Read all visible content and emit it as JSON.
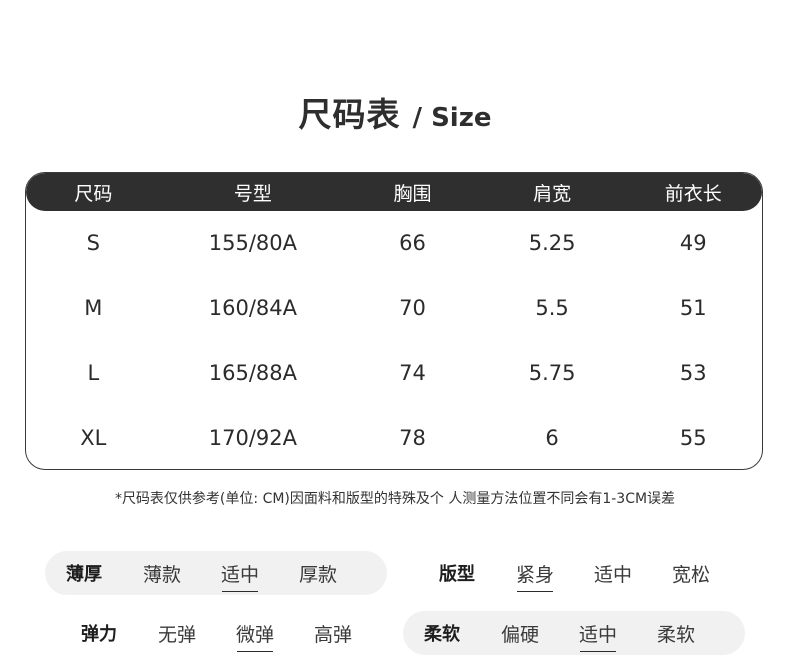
{
  "title": {
    "cn": "尺码表",
    "en": "/ Size"
  },
  "table": {
    "headers": [
      "尺码",
      "号型",
      "胸围",
      "肩宽",
      "前衣长"
    ],
    "rows": [
      [
        "S",
        "155/80A",
        "66",
        "5.25",
        "49"
      ],
      [
        "M",
        "160/84A",
        "70",
        "5.5",
        "51"
      ],
      [
        "L",
        "165/88A",
        "74",
        "5.75",
        "53"
      ],
      [
        "XL",
        "170/92A",
        "78",
        "6",
        "55"
      ]
    ]
  },
  "note": "*尺码表仅供参考(单位: CM)因面料和版型的特殊及个 人测量方法位置不同会有1-3CM误差",
  "attributes": {
    "thickness": {
      "label": "薄厚",
      "options": [
        "薄款",
        "适中",
        "厚款"
      ],
      "selected": "适中"
    },
    "fit": {
      "label": "版型",
      "options": [
        "紧身",
        "适中",
        "宽松"
      ],
      "selected": "紧身"
    },
    "elasticity": {
      "label": "弹力",
      "options": [
        "无弹",
        "微弹",
        "高弹"
      ],
      "selected": "微弹"
    },
    "softness": {
      "label": "柔软",
      "options": [
        "偏硬",
        "适中",
        "柔软"
      ],
      "selected": "适中"
    }
  }
}
